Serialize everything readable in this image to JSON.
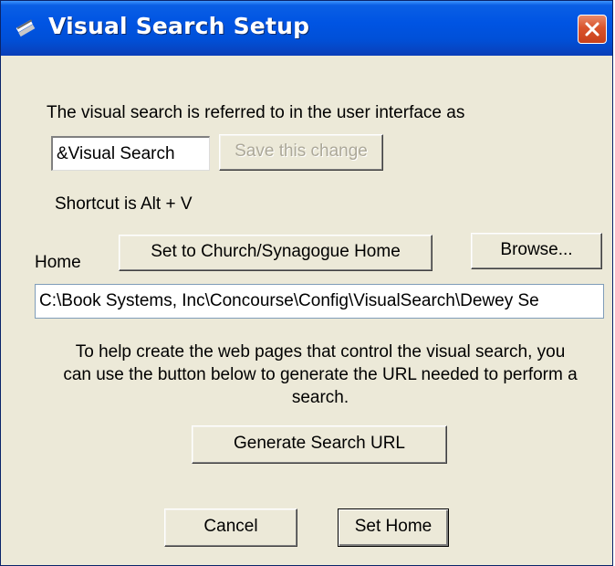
{
  "window": {
    "title": "Visual Search Setup",
    "title_icon": "books-icon",
    "close_icon": "close-icon"
  },
  "intro_text": "The visual search is referred to in the user interface as",
  "name_field": {
    "value": "&Visual Search"
  },
  "save_change_label": "Save this change",
  "shortcut_text": "Shortcut is Alt + V",
  "home_label": "Home",
  "set_church_label": "Set to Church/Synagogue Home",
  "browse_label": "Browse...",
  "home_path": {
    "value": "C:\\Book Systems, Inc\\Concourse\\Config\\VisualSearch\\Dewey Se"
  },
  "help_text": {
    "line1": "To help create the web pages that control the visual search, you",
    "line2": "can use the button below to generate the URL needed to perform a",
    "line3": "search."
  },
  "generate_url_label": "Generate Search URL",
  "cancel_label": "Cancel",
  "set_home_label": "Set Home",
  "colors": {
    "titlebar": "#0054e3",
    "dialog_bg": "#ece9d8",
    "close_button": "#d9542c"
  }
}
